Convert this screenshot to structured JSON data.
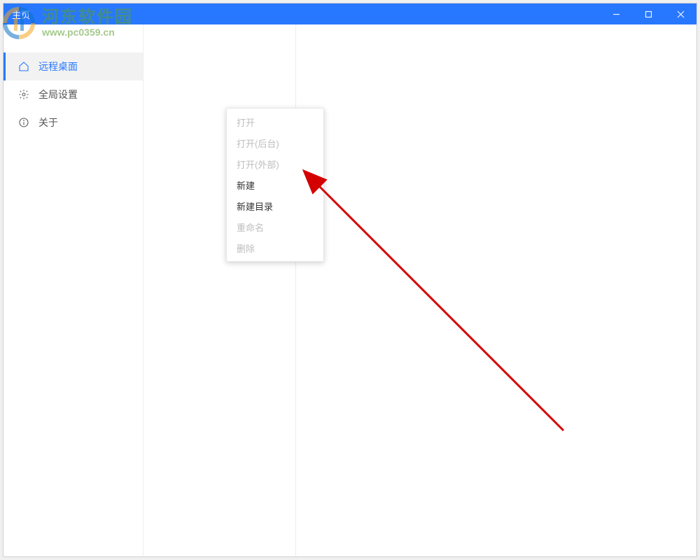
{
  "titlebar": {
    "title": "主页"
  },
  "sidebar": {
    "items": [
      {
        "label": "远程桌面"
      },
      {
        "label": "全局设置"
      },
      {
        "label": "关于"
      }
    ]
  },
  "context_menu": {
    "items": [
      {
        "label": "打开",
        "enabled": false
      },
      {
        "label": "打开(后台)",
        "enabled": false
      },
      {
        "label": "打开(外部)",
        "enabled": false
      },
      {
        "label": "新建",
        "enabled": true,
        "submenu": true
      },
      {
        "label": "新建目录",
        "enabled": true
      },
      {
        "label": "重命名",
        "enabled": false
      },
      {
        "label": "删除",
        "enabled": false
      }
    ]
  },
  "watermark": {
    "site_name": "河东软件园",
    "url": "www.pc0359.cn"
  }
}
